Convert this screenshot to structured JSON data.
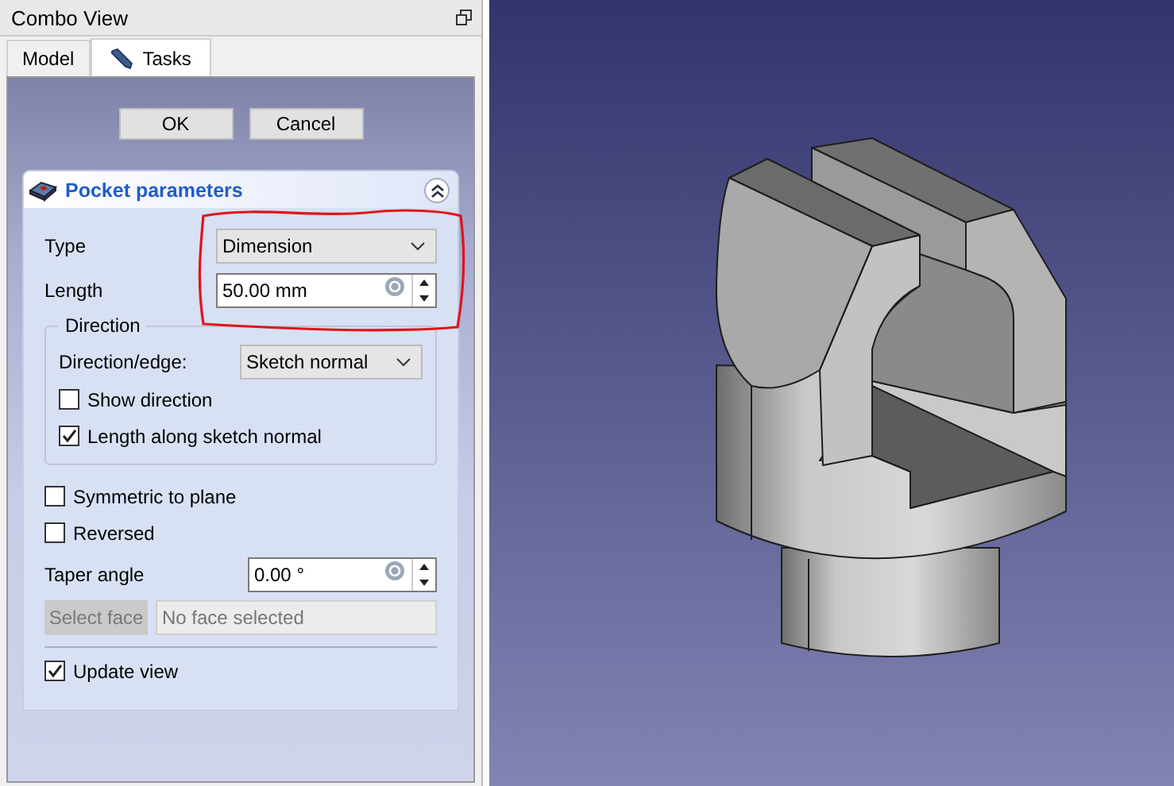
{
  "window": {
    "title": "Combo View"
  },
  "tabs": [
    {
      "label": "Model",
      "selected": false
    },
    {
      "label": "Tasks",
      "selected": true
    }
  ],
  "buttons": [
    {
      "label": "OK"
    },
    {
      "label": "Cancel"
    }
  ],
  "task_panel": {
    "title": "Pocket parameters",
    "expanded": true,
    "type": {
      "label": "Type",
      "value": "Dimension"
    },
    "length": {
      "label": "Length",
      "value": "50.00 mm"
    },
    "direction": {
      "title": "Direction",
      "edge_label": "Direction/edge:",
      "edge_value": "Sketch normal",
      "options": [
        {
          "label": "Show direction",
          "checked": false
        },
        {
          "label": "Length along sketch normal",
          "checked": true
        }
      ]
    },
    "options": [
      {
        "label": "Symmetric to plane",
        "checked": false
      },
      {
        "label": "Reversed",
        "checked": false
      }
    ],
    "taper": {
      "label": "Taper angle",
      "value": "0.00 °"
    },
    "face": {
      "button": "Select face",
      "placeholder": "No face selected",
      "disabled": true
    },
    "update_view": {
      "label": "Update view",
      "checked": true
    }
  }
}
